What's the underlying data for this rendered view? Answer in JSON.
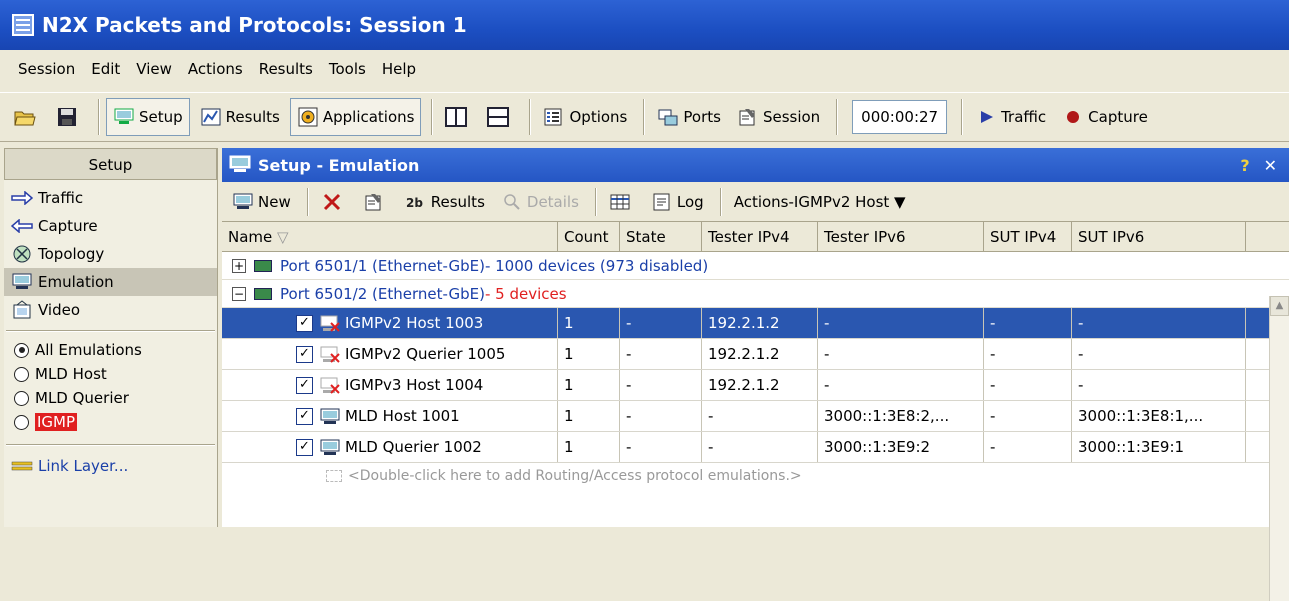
{
  "window": {
    "title": "N2X Packets and Protocols: Session 1"
  },
  "menu": [
    "Session",
    "Edit",
    "View",
    "Actions",
    "Results",
    "Tools",
    "Help"
  ],
  "toolbar": {
    "setup": "Setup",
    "results": "Results",
    "applications": "Applications",
    "options": "Options",
    "ports": "Ports",
    "session": "Session",
    "timer": "000:00:27",
    "traffic": "Traffic",
    "capture": "Capture"
  },
  "left": {
    "header": "Setup",
    "nav": [
      "Traffic",
      "Capture",
      "Topology",
      "Emulation",
      "Video"
    ],
    "filters": [
      "All Emulations",
      "MLD Host",
      "MLD Querier",
      "IGMP"
    ],
    "link": "Link Layer..."
  },
  "main": {
    "title": "Setup - Emulation",
    "help": "?",
    "close": "✕",
    "tools": {
      "new": "New",
      "results": "Results",
      "details": "Details",
      "log": "Log",
      "actions": "Actions-IGMPv2 Host ▼"
    },
    "columns": [
      "Name",
      "Count",
      "State",
      "Tester IPv4",
      "Tester IPv6",
      "SUT IPv4",
      "SUT IPv6"
    ],
    "groups": [
      {
        "name": "Port 6501/1 (Ethernet-GbE)",
        "info": " - 1000 devices (973 disabled)",
        "expander": "+"
      },
      {
        "name": "Port 6501/2 (Ethernet-GbE)",
        "info": " - 5 devices",
        "expander": "−"
      }
    ],
    "rows": [
      {
        "name": "IGMPv2 Host 1003",
        "count": "1",
        "state": "-",
        "tipv4": "192.2.1.2",
        "tipv6": "-",
        "sipv4": "-",
        "sipv6": "-"
      },
      {
        "name": "IGMPv2 Querier 1005",
        "count": "1",
        "state": "-",
        "tipv4": "192.2.1.2",
        "tipv6": "-",
        "sipv4": "-",
        "sipv6": "-"
      },
      {
        "name": "IGMPv3 Host 1004",
        "count": "1",
        "state": "-",
        "tipv4": "192.2.1.2",
        "tipv6": "-",
        "sipv4": "-",
        "sipv6": "-"
      },
      {
        "name": "MLD Host 1001",
        "count": "1",
        "state": "-",
        "tipv4": "-",
        "tipv6": "3000::1:3E8:2,...",
        "sipv4": "-",
        "sipv6": "3000::1:3E8:1,..."
      },
      {
        "name": "MLD Querier 1002",
        "count": "1",
        "state": "-",
        "tipv4": "-",
        "tipv6": "3000::1:3E9:2",
        "sipv4": "-",
        "sipv6": "3000::1:3E9:1"
      }
    ],
    "hint": "<Double-click here to add Routing/Access protocol emulations.>"
  },
  "colors": {
    "title": "#1c4fc2",
    "selected": "#2a57b0",
    "port_link": "#1a3fa8",
    "red": "#e02020"
  }
}
